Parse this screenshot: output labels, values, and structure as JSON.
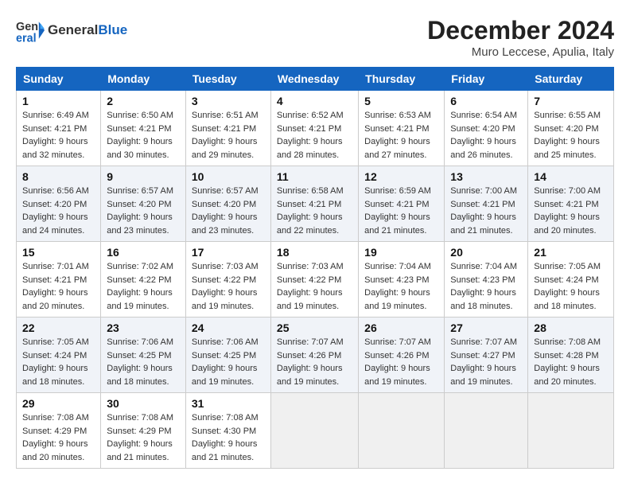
{
  "header": {
    "logo_general": "General",
    "logo_blue": "Blue",
    "month_title": "December 2024",
    "location": "Muro Leccese, Apulia, Italy"
  },
  "days_of_week": [
    "Sunday",
    "Monday",
    "Tuesday",
    "Wednesday",
    "Thursday",
    "Friday",
    "Saturday"
  ],
  "weeks": [
    [
      {
        "day": 1,
        "sunrise": "6:49 AM",
        "sunset": "4:21 PM",
        "daylight": "9 hours and 32 minutes."
      },
      {
        "day": 2,
        "sunrise": "6:50 AM",
        "sunset": "4:21 PM",
        "daylight": "9 hours and 30 minutes."
      },
      {
        "day": 3,
        "sunrise": "6:51 AM",
        "sunset": "4:21 PM",
        "daylight": "9 hours and 29 minutes."
      },
      {
        "day": 4,
        "sunrise": "6:52 AM",
        "sunset": "4:21 PM",
        "daylight": "9 hours and 28 minutes."
      },
      {
        "day": 5,
        "sunrise": "6:53 AM",
        "sunset": "4:21 PM",
        "daylight": "9 hours and 27 minutes."
      },
      {
        "day": 6,
        "sunrise": "6:54 AM",
        "sunset": "4:20 PM",
        "daylight": "9 hours and 26 minutes."
      },
      {
        "day": 7,
        "sunrise": "6:55 AM",
        "sunset": "4:20 PM",
        "daylight": "9 hours and 25 minutes."
      }
    ],
    [
      {
        "day": 8,
        "sunrise": "6:56 AM",
        "sunset": "4:20 PM",
        "daylight": "9 hours and 24 minutes."
      },
      {
        "day": 9,
        "sunrise": "6:57 AM",
        "sunset": "4:20 PM",
        "daylight": "9 hours and 23 minutes."
      },
      {
        "day": 10,
        "sunrise": "6:57 AM",
        "sunset": "4:20 PM",
        "daylight": "9 hours and 23 minutes."
      },
      {
        "day": 11,
        "sunrise": "6:58 AM",
        "sunset": "4:21 PM",
        "daylight": "9 hours and 22 minutes."
      },
      {
        "day": 12,
        "sunrise": "6:59 AM",
        "sunset": "4:21 PM",
        "daylight": "9 hours and 21 minutes."
      },
      {
        "day": 13,
        "sunrise": "7:00 AM",
        "sunset": "4:21 PM",
        "daylight": "9 hours and 21 minutes."
      },
      {
        "day": 14,
        "sunrise": "7:00 AM",
        "sunset": "4:21 PM",
        "daylight": "9 hours and 20 minutes."
      }
    ],
    [
      {
        "day": 15,
        "sunrise": "7:01 AM",
        "sunset": "4:21 PM",
        "daylight": "9 hours and 20 minutes."
      },
      {
        "day": 16,
        "sunrise": "7:02 AM",
        "sunset": "4:22 PM",
        "daylight": "9 hours and 19 minutes."
      },
      {
        "day": 17,
        "sunrise": "7:03 AM",
        "sunset": "4:22 PM",
        "daylight": "9 hours and 19 minutes."
      },
      {
        "day": 18,
        "sunrise": "7:03 AM",
        "sunset": "4:22 PM",
        "daylight": "9 hours and 19 minutes."
      },
      {
        "day": 19,
        "sunrise": "7:04 AM",
        "sunset": "4:23 PM",
        "daylight": "9 hours and 19 minutes."
      },
      {
        "day": 20,
        "sunrise": "7:04 AM",
        "sunset": "4:23 PM",
        "daylight": "9 hours and 18 minutes."
      },
      {
        "day": 21,
        "sunrise": "7:05 AM",
        "sunset": "4:24 PM",
        "daylight": "9 hours and 18 minutes."
      }
    ],
    [
      {
        "day": 22,
        "sunrise": "7:05 AM",
        "sunset": "4:24 PM",
        "daylight": "9 hours and 18 minutes."
      },
      {
        "day": 23,
        "sunrise": "7:06 AM",
        "sunset": "4:25 PM",
        "daylight": "9 hours and 18 minutes."
      },
      {
        "day": 24,
        "sunrise": "7:06 AM",
        "sunset": "4:25 PM",
        "daylight": "9 hours and 19 minutes."
      },
      {
        "day": 25,
        "sunrise": "7:07 AM",
        "sunset": "4:26 PM",
        "daylight": "9 hours and 19 minutes."
      },
      {
        "day": 26,
        "sunrise": "7:07 AM",
        "sunset": "4:26 PM",
        "daylight": "9 hours and 19 minutes."
      },
      {
        "day": 27,
        "sunrise": "7:07 AM",
        "sunset": "4:27 PM",
        "daylight": "9 hours and 19 minutes."
      },
      {
        "day": 28,
        "sunrise": "7:08 AM",
        "sunset": "4:28 PM",
        "daylight": "9 hours and 20 minutes."
      }
    ],
    [
      {
        "day": 29,
        "sunrise": "7:08 AM",
        "sunset": "4:29 PM",
        "daylight": "9 hours and 20 minutes."
      },
      {
        "day": 30,
        "sunrise": "7:08 AM",
        "sunset": "4:29 PM",
        "daylight": "9 hours and 21 minutes."
      },
      {
        "day": 31,
        "sunrise": "7:08 AM",
        "sunset": "4:30 PM",
        "daylight": "9 hours and 21 minutes."
      },
      null,
      null,
      null,
      null
    ]
  ]
}
